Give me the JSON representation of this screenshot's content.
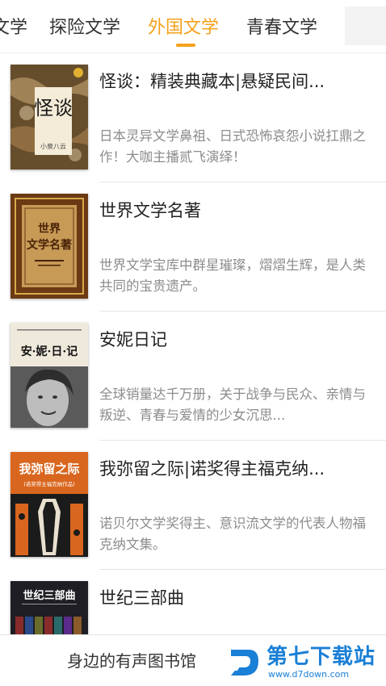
{
  "tabs": [
    {
      "label": "文学",
      "active": false
    },
    {
      "label": "探险文学",
      "active": false
    },
    {
      "label": "外国文学",
      "active": true
    },
    {
      "label": "青春文学",
      "active": false
    }
  ],
  "books": [
    {
      "title": "怪谈：精装典藏本|悬疑民间...",
      "desc": "日本灵异文学鼻祖、日式恐怖哀怨小说扛鼎之作！大咖主播贰飞演绎！",
      "cover_text": "怪谈",
      "cover_sub": "小泉八云"
    },
    {
      "title": "世界文学名著",
      "desc": "世界文学宝库中群星璀璨，熠熠生辉，是人类共同的宝贵遗产。",
      "cover_text_1": "世界",
      "cover_text_2": "文学名著"
    },
    {
      "title": "安妮日记",
      "desc": "全球销量达千万册，关于战争与民众、亲情与叛逆、青春与爱情的少女沉思...",
      "cover_text": "安·妮·日·记"
    },
    {
      "title": "我弥留之际|诺奖得主福克纳...",
      "desc": "诺贝尔文学奖得主、意识流文学的代表人物福克纳文集。",
      "cover_text": "我弥留之际",
      "cover_sub": "(诺奖得主福克纳作品)"
    },
    {
      "title": "世纪三部曲",
      "desc": "",
      "cover_text": "世纪三部曲"
    }
  ],
  "bottom": {
    "slogan": "身边的有声图书馆"
  },
  "watermark": {
    "name": "第七下载站",
    "url": "www.d7down.com"
  },
  "colors": {
    "accent": "#f5a11c",
    "watermark": "#1a7fd6"
  }
}
